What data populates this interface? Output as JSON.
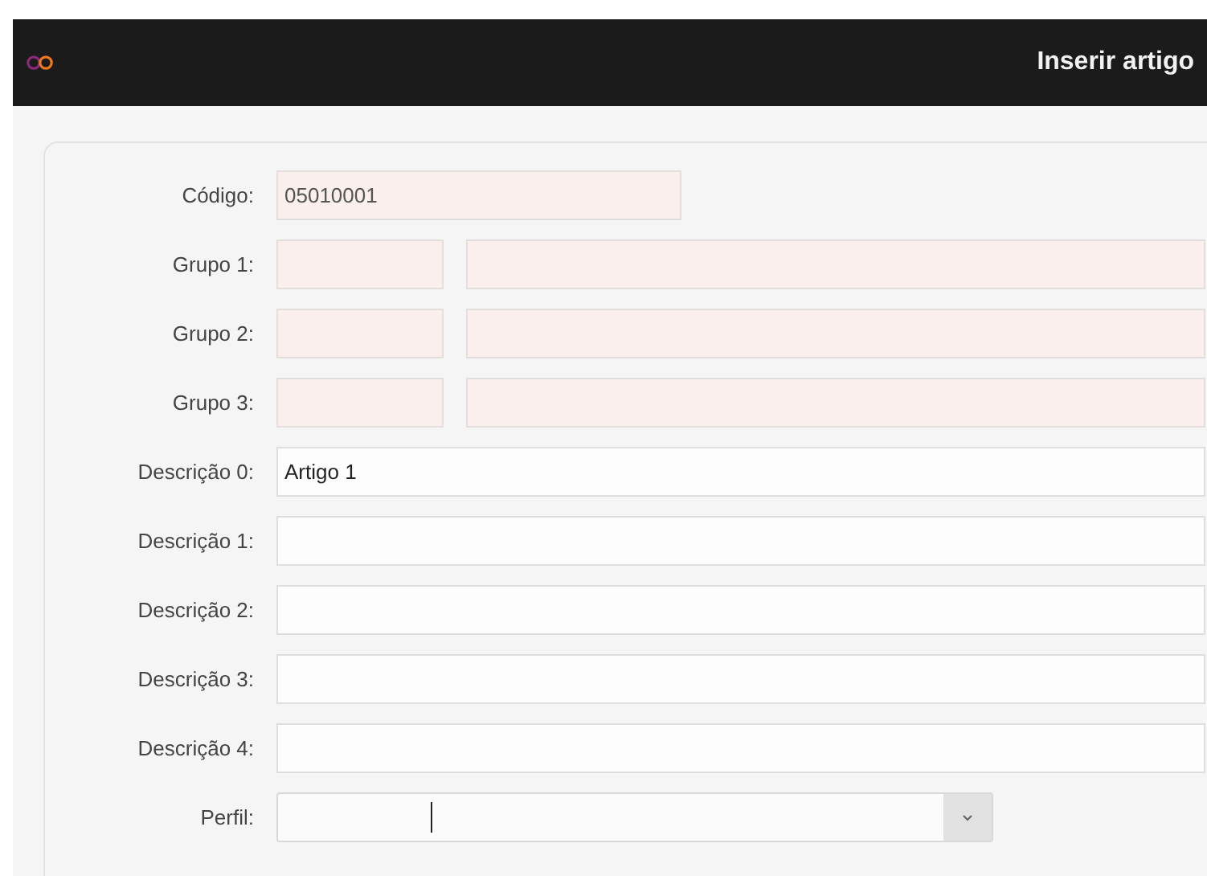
{
  "header": {
    "title": "Inserir artigo"
  },
  "rows": [
    {
      "label": "Código:",
      "kind": "code",
      "fields": [
        {
          "value": "05010001",
          "readonly": true
        }
      ]
    },
    {
      "label": "Grupo 1:",
      "kind": "pair",
      "fields": [
        {
          "readonly": true
        },
        {
          "readonly": true
        }
      ]
    },
    {
      "label": "Grupo 2:",
      "kind": "pair",
      "fields": [
        {
          "readonly": true
        },
        {
          "readonly": true
        }
      ]
    },
    {
      "label": "Grupo 3:",
      "kind": "pair",
      "fields": [
        {
          "readonly": true
        },
        {
          "readonly": true
        }
      ]
    },
    {
      "label": "Descrição 0:",
      "kind": "full",
      "fields": [
        {
          "value": "Artigo 1",
          "readonly": false
        }
      ]
    },
    {
      "label": "Descrição 1:",
      "kind": "full",
      "fields": [
        {
          "readonly": false
        }
      ]
    },
    {
      "label": "Descrição 2:",
      "kind": "full",
      "fields": [
        {
          "readonly": false
        }
      ]
    },
    {
      "label": "Descrição 3:",
      "kind": "full",
      "fields": [
        {
          "readonly": false
        }
      ]
    },
    {
      "label": "Descrição 4:",
      "kind": "full",
      "fields": [
        {
          "readonly": false
        }
      ]
    },
    {
      "label": "Perfil:",
      "kind": "select",
      "fields": [
        {
          "readonly": false
        }
      ]
    }
  ]
}
